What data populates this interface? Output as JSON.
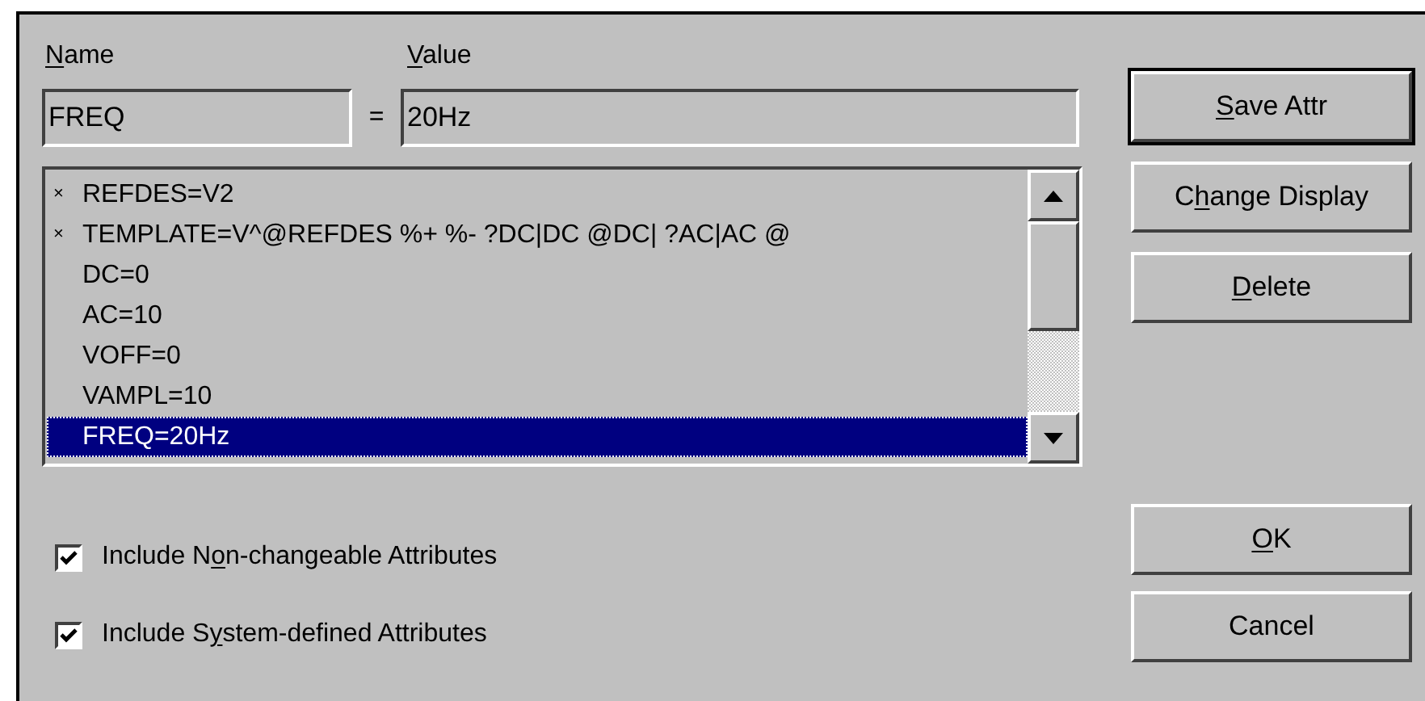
{
  "name_field": {
    "label": {
      "key": "N",
      "after": "ame"
    },
    "value": "FREQ"
  },
  "equals": "=",
  "value_field": {
    "label": {
      "key": "V",
      "after": "alue"
    },
    "value": "20Hz"
  },
  "attributes": [
    {
      "marker": "×",
      "text": "REFDES=V2",
      "selected": false
    },
    {
      "marker": "×",
      "text": "TEMPLATE=V^@REFDES %+ %- ?DC|DC @DC| ?AC|AC @",
      "selected": false
    },
    {
      "text": "DC=0",
      "selected": false
    },
    {
      "text": "AC=10",
      "selected": false
    },
    {
      "text": "VOFF=0",
      "selected": false
    },
    {
      "text": "VAMPL=10",
      "selected": false
    },
    {
      "text": "FREQ=20Hz",
      "selected": true
    }
  ],
  "side_buttons": [
    {
      "key": "S",
      "after": "ave Attr",
      "default": true
    },
    {
      "before": "C",
      "key": "h",
      "after": "ange Display",
      "default": false
    },
    {
      "key": "D",
      "after": "elete",
      "default": false
    }
  ],
  "options": [
    {
      "before": "Include N",
      "key": "o",
      "after": "n-changeable Attributes",
      "checked": true
    },
    {
      "before": "Include S",
      "key": "y",
      "after": "stem-defined Attributes",
      "checked": true
    }
  ],
  "bottom_buttons": [
    {
      "key": "O",
      "after": "K",
      "default": false
    },
    {
      "before": "Cancel",
      "default": false
    }
  ]
}
